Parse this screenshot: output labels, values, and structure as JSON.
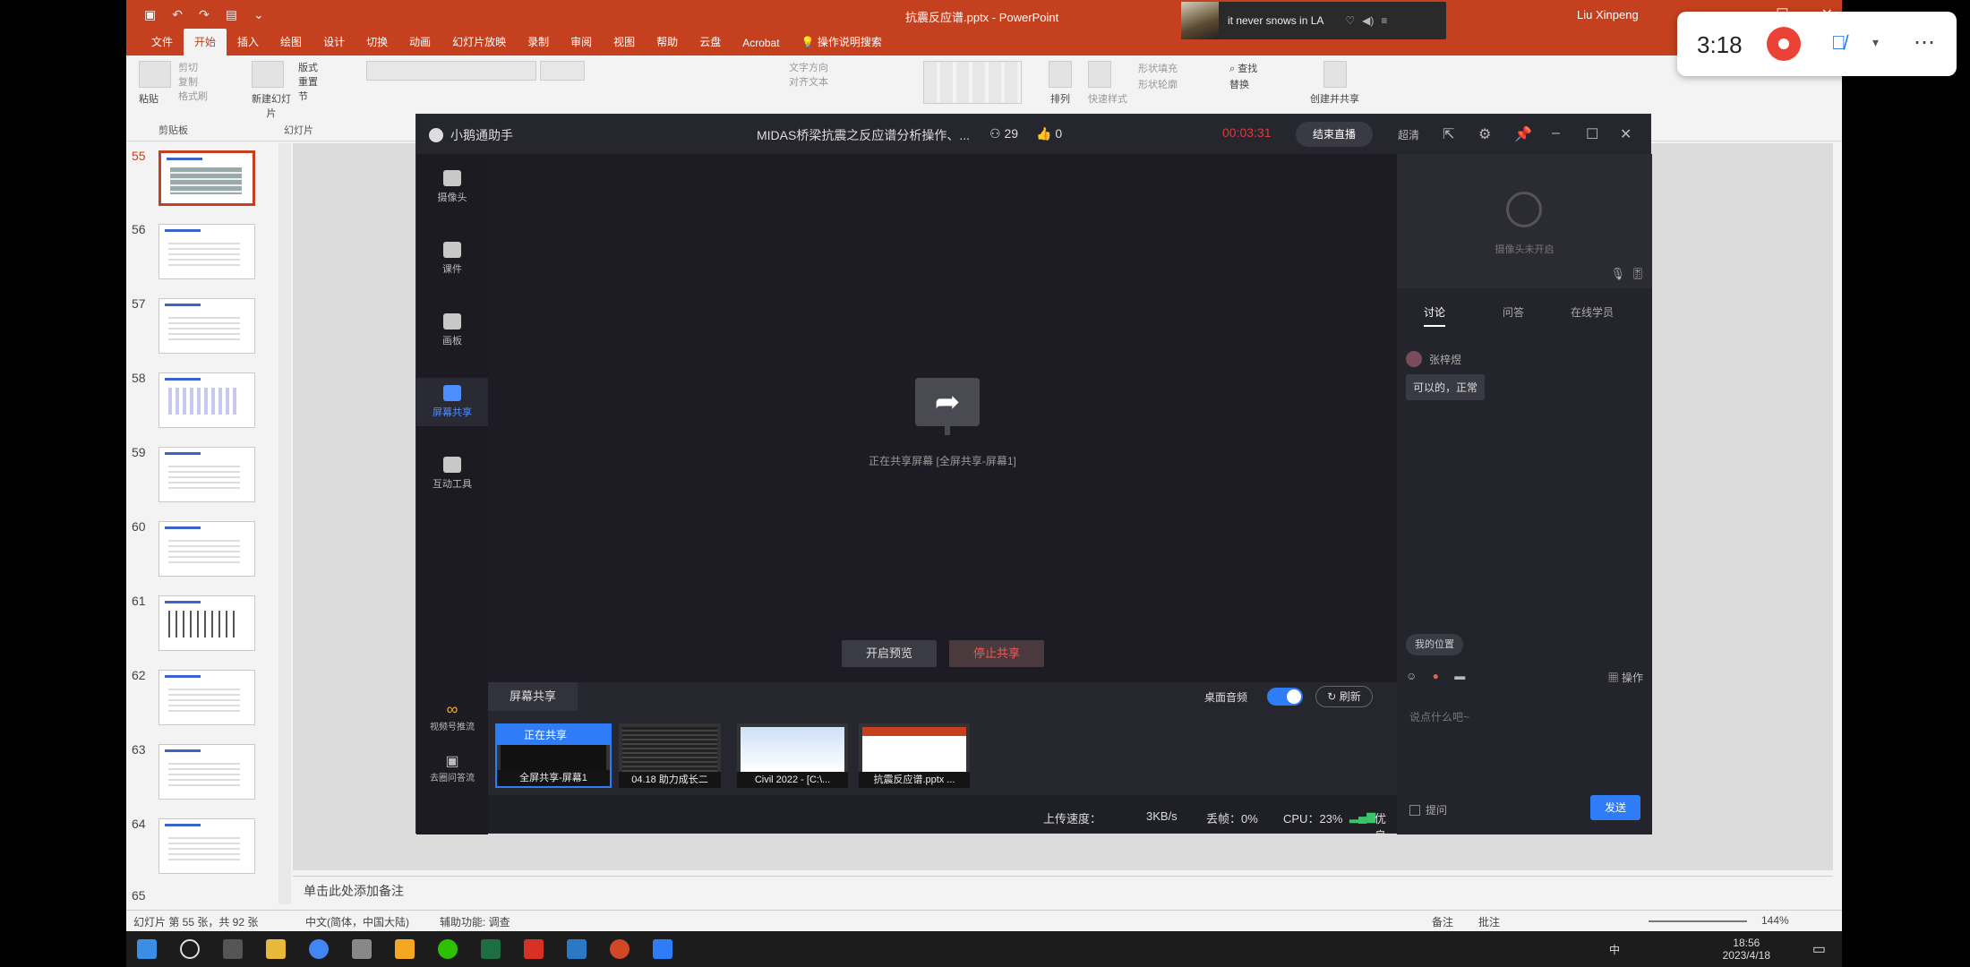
{
  "ppt": {
    "document_title": "抗震反应谱.pptx - PowerPoint",
    "user": "Liu Xinpeng",
    "music": {
      "track": "it never snows in LA"
    },
    "tabs": [
      "文件",
      "开始",
      "插入",
      "绘图",
      "设计",
      "切换",
      "动画",
      "幻灯片放映",
      "录制",
      "审阅",
      "视图",
      "帮助",
      "云盘",
      "Acrobat",
      "操作说明搜索"
    ],
    "active_tab": "开始",
    "ribbon": {
      "paste": "粘贴",
      "cut": "剪切",
      "copy": "复制",
      "format_painter": "格式刷",
      "clipboard": "剪贴板",
      "new_slide": "新建幻灯片",
      "layout": "版式",
      "reset": "重置",
      "section": "节",
      "slides_group": "幻灯片",
      "text_dir": "文字方向",
      "align_text": "对齐文本",
      "arrange": "排列",
      "quick_styles": "快速样式",
      "shape_fill": "形状填充",
      "shape_outline": "形状轮廓",
      "find": "查找",
      "replace": "替换",
      "create_share": "创建并共享"
    },
    "slides": [
      55,
      56,
      57,
      58,
      59,
      60,
      61,
      62,
      63,
      64,
      65
    ],
    "selected_slide": 55,
    "notes_placeholder": "单击此处添加备注",
    "status": {
      "slide_count": "幻灯片 第 55 张，共 92 张",
      "language": "中文(简体，中国大陆)",
      "accessibility": "辅助功能: 调查",
      "notes": "备注",
      "comments": "批注",
      "zoom": "144%"
    }
  },
  "taskbar": {
    "time": "18:56",
    "date": "2023/4/18",
    "ime": "中"
  },
  "live": {
    "app_name": "小鹅通助手",
    "course_title": "MIDAS桥梁抗震之反应谱分析操作、...",
    "viewers": "29",
    "likes": "0",
    "timer": "00:03:31",
    "end_live": "结束直播",
    "quality": "超清",
    "side": [
      "摄像头",
      "课件",
      "画板",
      "屏幕共享",
      "互动工具"
    ],
    "side_bottom": [
      "视频号推流",
      "去圈问答流"
    ],
    "sharing_status": "正在共享屏幕 [全屏共享-屏幕1]",
    "btn_preview": "开启预览",
    "btn_stop": "停止共享",
    "share_tab": "屏幕共享",
    "system_audio": "桌面音频",
    "refresh": "刷新",
    "sources": [
      {
        "badge": "正在共享",
        "caption": "全屏共享-屏幕1"
      },
      {
        "caption": "04.18 助力成长二"
      },
      {
        "caption": "Civil 2022 - [C:\\..."
      },
      {
        "caption": "抗震反应谱.pptx ..."
      }
    ],
    "stats": {
      "upload_label": "上传速度：",
      "upload": "3KB/s",
      "loss": "丢帧：0%",
      "cpu": "CPU：23%",
      "quality": "优良"
    },
    "camera_off": "摄像头未开启",
    "chat_tabs": [
      "讨论",
      "问答",
      "在线学员"
    ],
    "chat": {
      "user": "张梓煜",
      "message": "可以的，正常"
    },
    "my_location": "我的位置",
    "ops": "操作",
    "input_placeholder": "说点什么吧~",
    "ask_label": "提问",
    "send": "发送"
  },
  "recorder": {
    "elapsed": "3:18"
  }
}
